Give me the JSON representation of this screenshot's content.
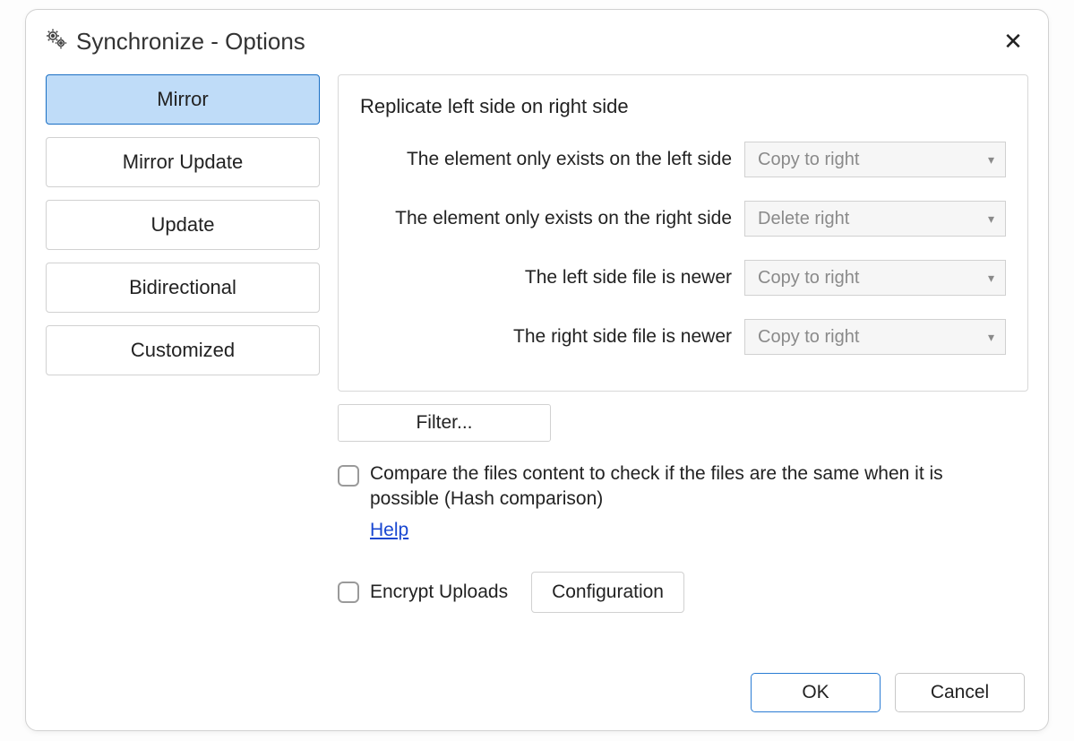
{
  "window": {
    "title": "Synchronize - Options",
    "close_icon": "✕"
  },
  "sidebar": {
    "items": [
      {
        "label": "Mirror",
        "active": true
      },
      {
        "label": "Mirror Update",
        "active": false
      },
      {
        "label": "Update",
        "active": false
      },
      {
        "label": "Bidirectional",
        "active": false
      },
      {
        "label": "Customized",
        "active": false
      }
    ]
  },
  "panel": {
    "heading": "Replicate left side on right side",
    "rules": [
      {
        "label": "The element only exists on the left side",
        "value": "Copy to right"
      },
      {
        "label": "The element only exists on the right side",
        "value": "Delete right"
      },
      {
        "label": "The left side file is newer",
        "value": "Copy to right"
      },
      {
        "label": "The right side file is newer",
        "value": "Copy to right"
      }
    ]
  },
  "filter_button": "Filter...",
  "compare_checkbox": {
    "label": "Compare the files content to check if the files are the same when it is possible (Hash comparison)",
    "checked": false
  },
  "help_link": "Help",
  "encrypt_checkbox": {
    "label": "Encrypt Uploads",
    "checked": false
  },
  "configuration_button": "Configuration",
  "footer": {
    "ok": "OK",
    "cancel": "Cancel"
  }
}
